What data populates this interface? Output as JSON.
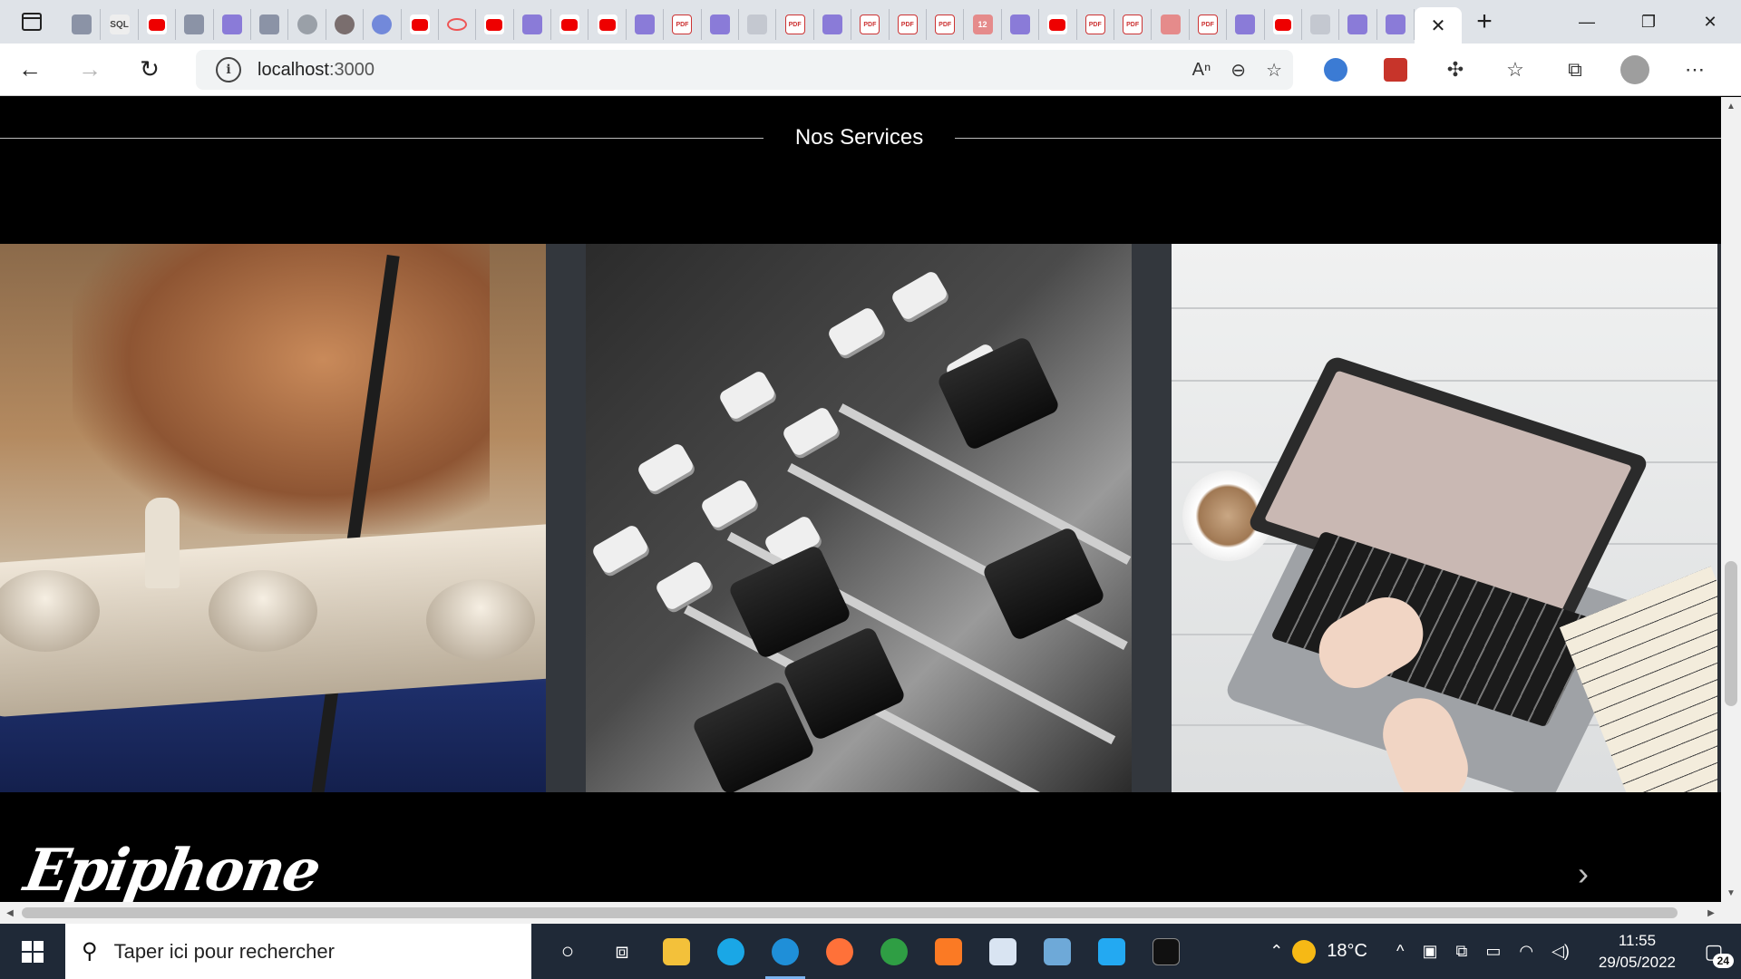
{
  "browser": {
    "address": {
      "host": "localhost",
      "port": ":3000"
    },
    "tab_favicons": [
      "react-icon",
      "sql-icon",
      "youtube-icon",
      "react-icon",
      "purple-app-icon",
      "react-icon",
      "gear-icon",
      "avatar-icon",
      "discord-icon",
      "youtube-icon",
      "oval-icon",
      "youtube-icon",
      "purple-app-icon",
      "youtube-icon",
      "youtube-icon",
      "purple-app-icon",
      "pdf-icon",
      "purple-app-icon",
      "flag-icon",
      "pdf-icon",
      "purple-app-icon",
      "pdf-icon",
      "pdf-icon",
      "pdf-icon",
      "badge-icon",
      "purple-app-icon",
      "youtube-icon",
      "pdf-icon",
      "pdf-icon",
      "pen-icon",
      "pdf-icon",
      "grid-icon",
      "youtube-icon",
      "page-icon",
      "purple-app-icon",
      "purple-app-icon"
    ],
    "tab_badge": "12",
    "sql_label": "SQL",
    "pdf_label": "PDF"
  },
  "page": {
    "section_title": "Nos Services",
    "cards": [
      {
        "image": "guitar-repair-image"
      },
      {
        "image": "mixing-console-image"
      },
      {
        "image": "laptop-music-sheet-image"
      }
    ],
    "logo_text": "Epiphone",
    "next_arrow": "›"
  },
  "taskbar": {
    "search_placeholder": "Taper ici pour rechercher",
    "temperature": "18°C",
    "time": "11:55",
    "date": "29/05/2022",
    "notification_count": "24"
  },
  "colors": {
    "page_bg": "#000000",
    "taskbar_bg": "#1f2937",
    "tabstrip_bg": "#dfe3e8",
    "card_gap": "#33373d"
  }
}
